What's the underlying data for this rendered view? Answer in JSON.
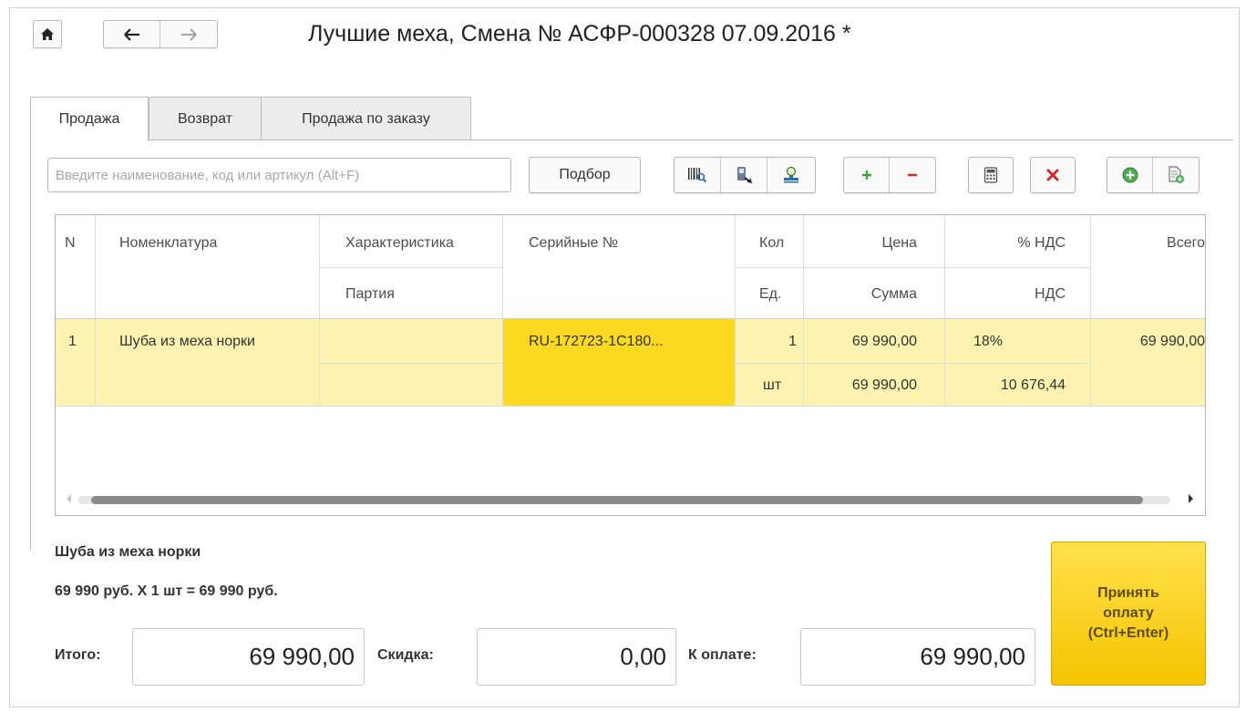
{
  "window": {
    "title": "Лучшие меха, Смена № АСФР-000328  07.09.2016 *",
    "nav_icons": [
      "home-icon",
      "back-arrow-icon",
      "forward-arrow-icon"
    ]
  },
  "tabs": [
    {
      "label": "Продажа",
      "active": true
    },
    {
      "label": "Возврат",
      "active": false
    },
    {
      "label": "Продажа по заказу",
      "active": false
    }
  ],
  "toolbar": {
    "search_placeholder": "Введите наименование, код или артикул (Alt+F)",
    "select_label": "Подбор",
    "icons": [
      "barcode-search-icon",
      "scanner-icon",
      "stamp-icon",
      "plus-icon",
      "minus-icon",
      "calculator-icon",
      "delete-icon",
      "add-circle-icon",
      "add-document-icon"
    ]
  },
  "table": {
    "headers": {
      "n": "N",
      "nomenclature": "Номенклатура",
      "characteristic": "Характеристика",
      "batch": "Партия",
      "serial": "Серийные №",
      "qty": "Кол",
      "unit": "Ед.",
      "price": "Цена",
      "sum": "Сумма",
      "vat_rate": "% НДС",
      "vat": "НДС",
      "total": "Всего"
    },
    "rows": [
      {
        "n": "1",
        "nomenclature": "Шуба из меха норки",
        "characteristic": "",
        "batch": "",
        "serial": "RU-172723-1C180...",
        "qty": "1",
        "unit": "шт",
        "price": "69 990,00",
        "sum": "69 990,00",
        "vat_rate": "18%",
        "vat": "10 676,44",
        "total": "69 990,00"
      }
    ]
  },
  "summary": {
    "item_name": "Шуба из меха норки",
    "calc_line": "69 990 руб. Х 1 шт = 69 990 руб."
  },
  "totals": {
    "total_label": "Итого:",
    "total_value": "69 990,00",
    "discount_label": "Скидка:",
    "discount_value": "0,00",
    "to_pay_label": "К оплате:",
    "to_pay_value": "69 990,00"
  },
  "pay_button": {
    "label_line1": "Принять",
    "label_line2": "оплату",
    "label_line3": "(Ctrl+Enter)"
  },
  "colors": {
    "row_highlight": "#fcf3b0",
    "selected_cell": "#fbd923",
    "pay_button": "#f9d21a",
    "plus_green": "#3aa635",
    "minus_red": "#d9262a"
  }
}
